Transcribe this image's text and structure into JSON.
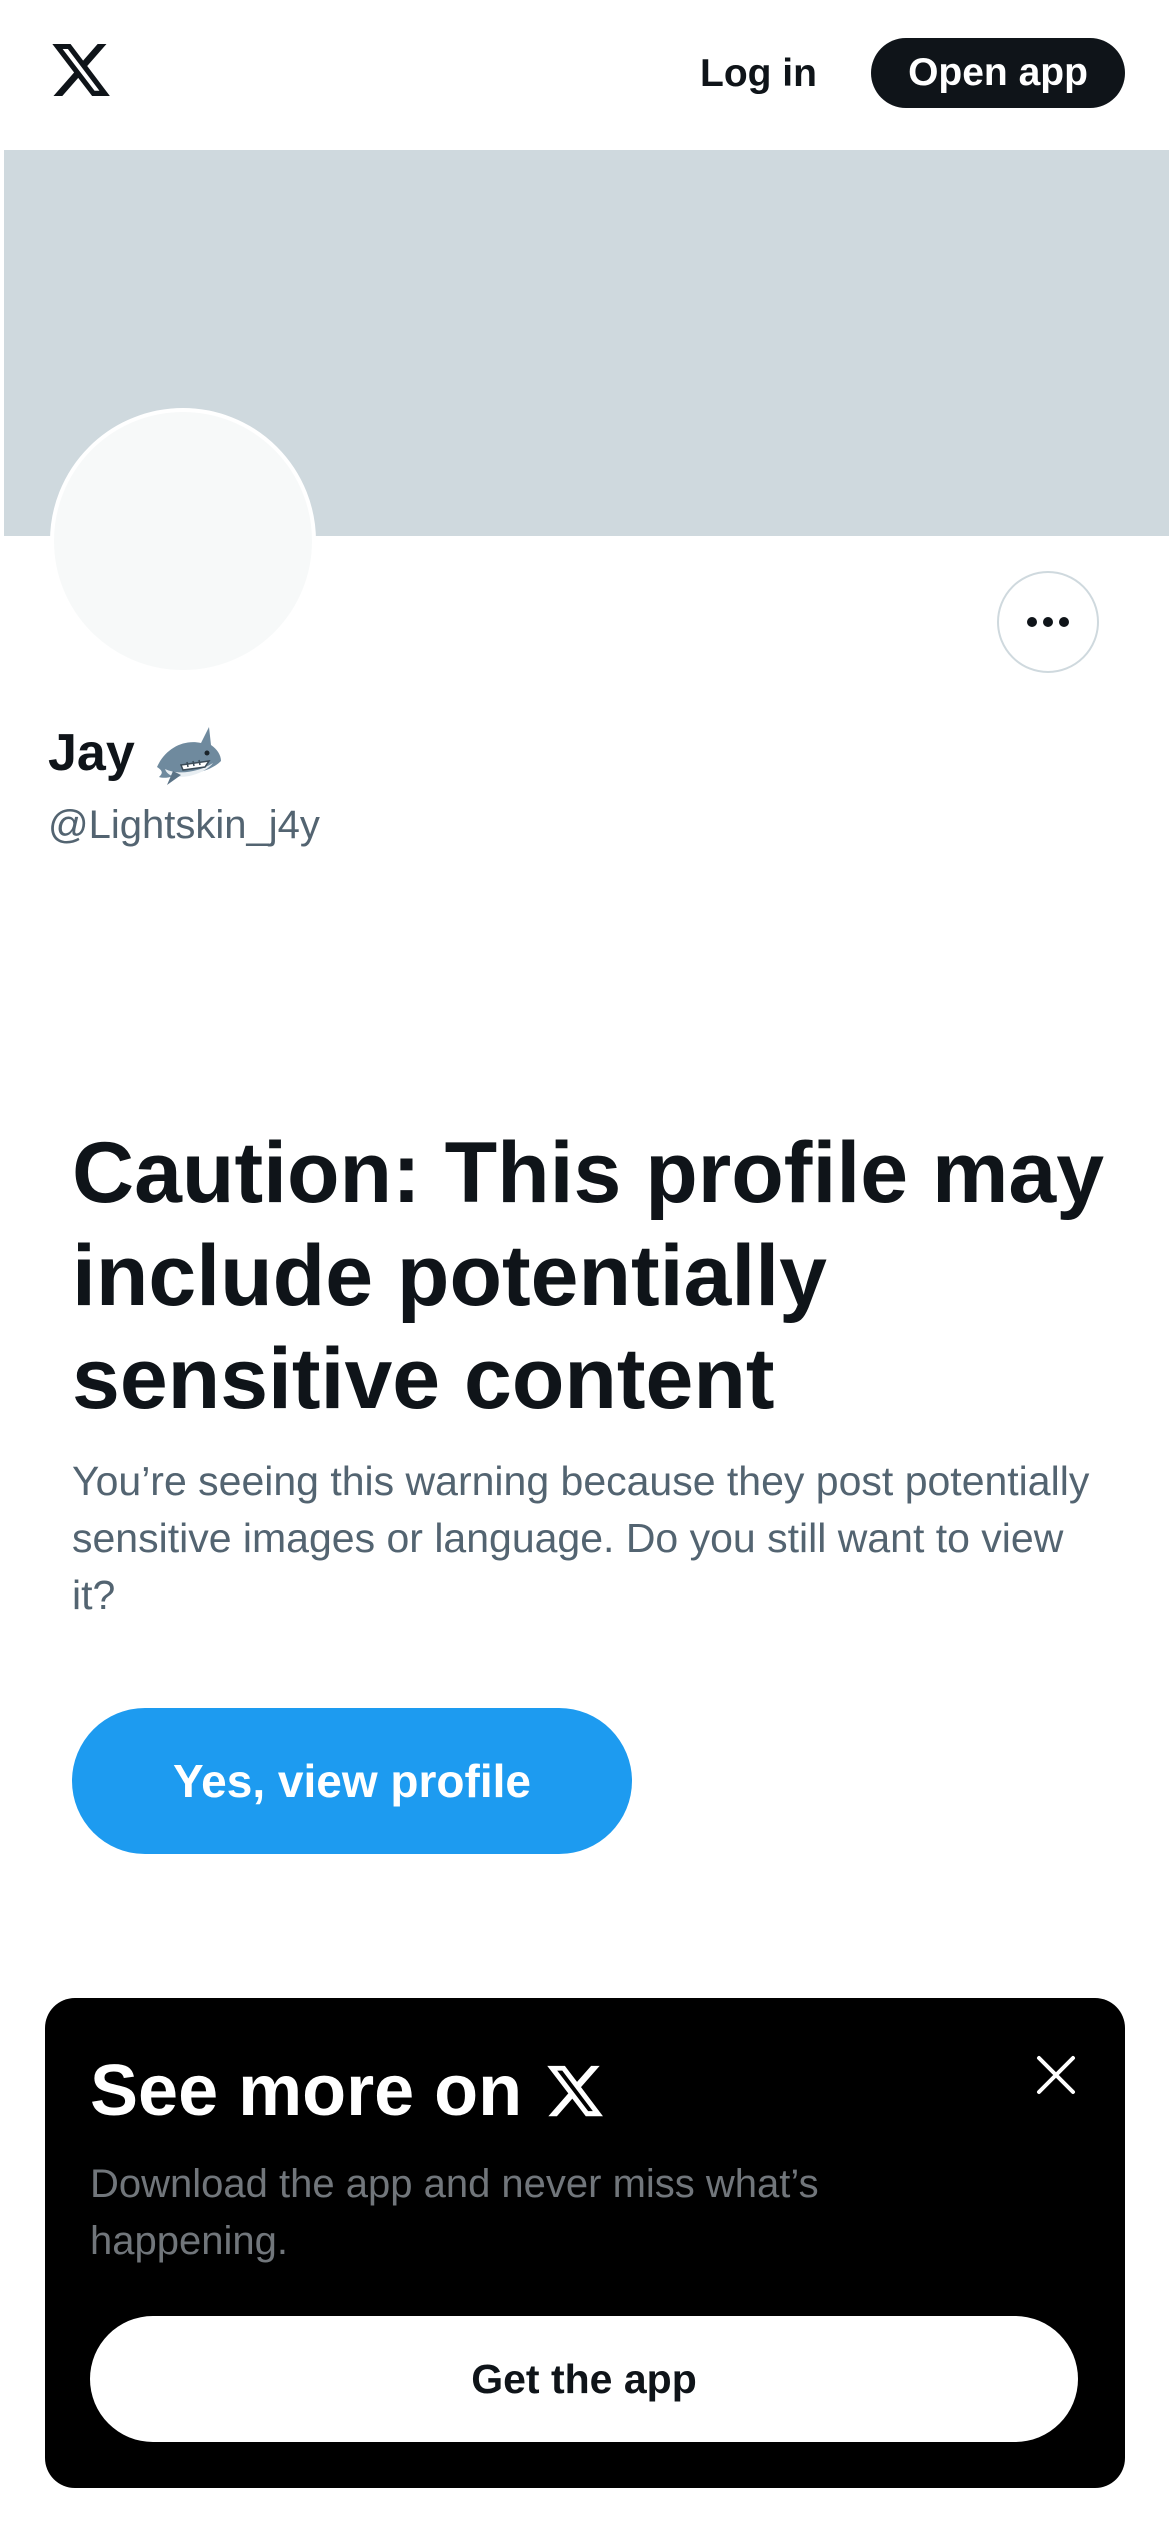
{
  "header": {
    "logo_icon": "x-logo-icon",
    "login_label": "Log in",
    "open_app_label": "Open app"
  },
  "profile": {
    "display_name": "Jay",
    "name_emoji": "shark-emoji",
    "handle": "@Lightskin_j4y",
    "banner_color": "#cfd9de",
    "avatar_color": "#f7f9f9"
  },
  "warning": {
    "title": "Caution: This profile may include potentially sensitive content",
    "body": "You’re seeing this warning because they post potentially sensitive images or language. Do you still want to view it?",
    "button_label": "Yes, view profile",
    "button_color": "#1d9bf0"
  },
  "promo_sheet": {
    "title": "See more on",
    "title_icon": "x-logo-icon",
    "body": "Download the app and never miss what’s happening.",
    "button_label": "Get the app",
    "close_icon": "close-icon"
  }
}
